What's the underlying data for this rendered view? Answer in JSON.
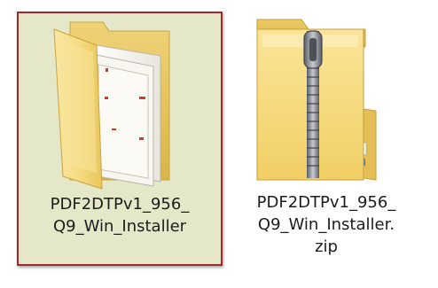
{
  "files": [
    {
      "type": "folder",
      "selected": true,
      "icon": "open-folder-icon",
      "label_lines": [
        "PDF2DTPv1_956_",
        "Q9_Win_Installer"
      ]
    },
    {
      "type": "zip",
      "selected": false,
      "icon": "zip-folder-icon",
      "label_lines": [
        "PDF2DTPv1_956_",
        "Q9_Win_Installer.",
        "zip"
      ]
    }
  ],
  "colors": {
    "selection_border": "#a3282e",
    "selection_fill": "#e5e8c8",
    "folder_yellow": "#f3d56e",
    "text": "#1c1c1c"
  }
}
